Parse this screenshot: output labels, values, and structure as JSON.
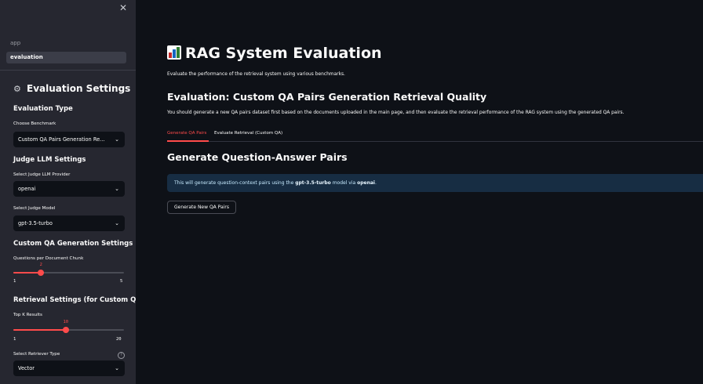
{
  "sidebar": {
    "close_icon": "close-icon",
    "nav": [
      {
        "label": "app",
        "selected": false
      },
      {
        "label": "evaluation",
        "selected": true
      }
    ],
    "title": "Evaluation Settings",
    "title_icon": "gear-icon",
    "evaluation_type": {
      "heading": "Evaluation Type",
      "label": "Choose Benchmark",
      "value": "Custom QA Pairs Generation Re..."
    },
    "judge": {
      "heading": "Judge LLM Settings",
      "provider_label": "Select Judge LLM Provider",
      "provider_value": "openai",
      "model_label": "Select Judge Model",
      "model_value": "gpt-3.5-turbo"
    },
    "custom_qa": {
      "heading": "Custom QA Generation Settings",
      "slider_label": "Questions per Document Chunk",
      "value": 2,
      "min": 1,
      "max": 5
    },
    "retrieval": {
      "heading": "Retrieval Settings (for Custom QA)",
      "topk_label": "Top K Results",
      "topk_value": 10,
      "topk_min": 1,
      "topk_max": 20,
      "retriever_label": "Select Retriever Type",
      "retriever_value": "Vector",
      "help_icon": "help-circle-icon"
    }
  },
  "main": {
    "title": "RAG System Evaluation",
    "title_icon": "bar-chart-icon",
    "caption": "Evaluate the performance of the retrieval system using various benchmarks.",
    "section_title": "Evaluation: Custom QA Pairs Generation Retrieval Quality",
    "section_caption": "You should generate a new QA pairs dataset first based on the documents uploaded in the main page, and then evaluate the retrieval performance of the RAG system using the generated QA pairs.",
    "tabs": [
      {
        "label": "Generate QA Pairs",
        "active": true
      },
      {
        "label": "Evaluate Retrieval (Custom QA)",
        "active": false
      }
    ],
    "generate_heading": "Generate Question-Answer Pairs",
    "info": {
      "prefix": "This will generate question-context pairs using the ",
      "model": "gpt-3.5-turbo",
      "middle": " model via ",
      "provider": "openai",
      "suffix": "."
    },
    "generate_button": "Generate New QA Pairs"
  },
  "colors": {
    "background": "#0e1117",
    "sidebar": "#262730",
    "accent": "#ff4b4b",
    "info_bg": "#172d43"
  }
}
